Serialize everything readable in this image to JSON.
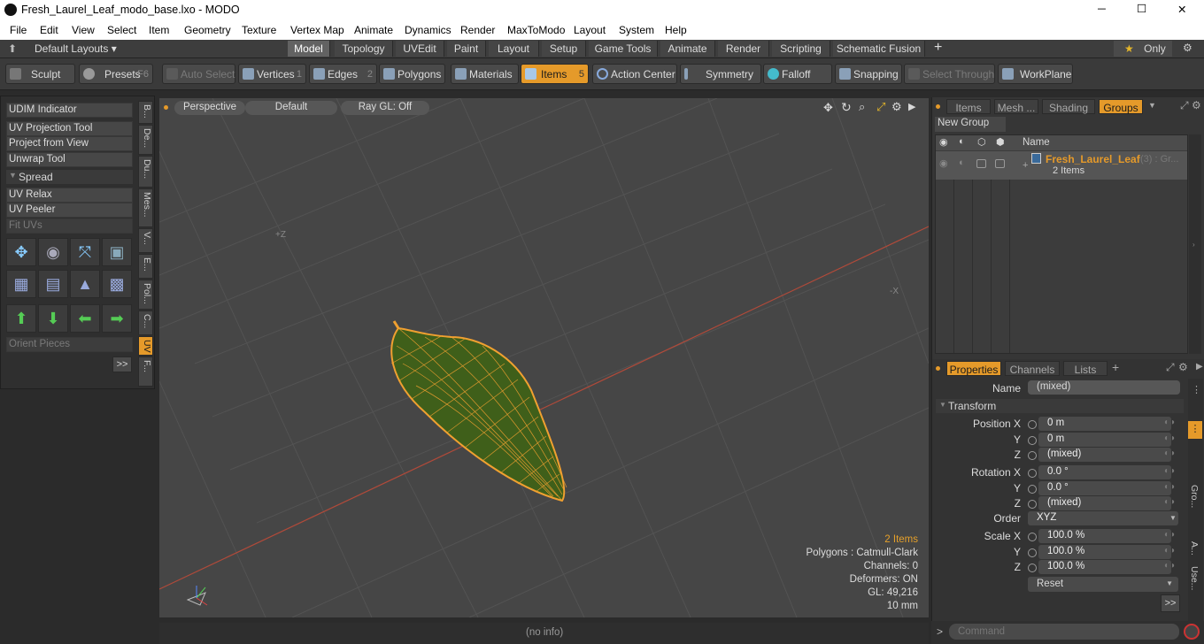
{
  "window": {
    "title": "Fresh_Laurel_Leaf_modo_base.lxo - MODO",
    "minimize": "─",
    "maximize": "☐",
    "close": "✕"
  },
  "menu": [
    "File",
    "Edit",
    "View",
    "Select",
    "Item",
    "Geometry",
    "Texture",
    "Vertex Map",
    "Animate",
    "Dynamics",
    "Render",
    "MaxToModo",
    "Layout",
    "System",
    "Help"
  ],
  "layouts": {
    "label": "Default Layouts ▾",
    "tabs": [
      "Model",
      "Topology",
      "UVEdit",
      "Paint",
      "Layout",
      "Setup",
      "Game Tools",
      "Animate",
      "Render",
      "Scripting",
      "Schematic Fusion"
    ],
    "active": "Model",
    "add": "+",
    "only": "Only"
  },
  "toolbar": {
    "sculpt": "Sculpt",
    "presets": "Presets",
    "presets_key": "F6",
    "auto_select": "Auto Select",
    "vertices": "Vertices",
    "vertices_key": "1",
    "edges": "Edges",
    "edges_key": "2",
    "polygons": "Polygons",
    "materials": "Materials",
    "items": "Items",
    "items_key": "5",
    "action_center": "Action Center",
    "symmetry": "Symmetry",
    "falloff": "Falloff",
    "snapping": "Snapping",
    "select_through": "Select Through",
    "workplane": "WorkPlane"
  },
  "left": {
    "udim": "UDIM Indicator",
    "uv_projection": "UV Projection Tool",
    "project_from_view": "Project from View",
    "unwrap": "Unwrap Tool",
    "spread": "Spread",
    "uv_relax": "UV Relax",
    "uv_peeler": "UV Peeler",
    "fit_uvs": "Fit UVs",
    "orient": "Orient Pieces",
    "more": ">>",
    "vtabs": [
      "B...",
      "De...",
      "Du...",
      "Mes...",
      "V...",
      "E...",
      "Pol...",
      "C...",
      "UV",
      "F..."
    ]
  },
  "viewport": {
    "perspective": "Perspective",
    "default": "Default",
    "raygl": "Ray GL: Off",
    "plus_z": "+Z",
    "minus_x": "-X",
    "info": {
      "items": "2 Items",
      "polygons": "Polygons : Catmull-Clark",
      "channels": "Channels: 0",
      "deformers": "Deformers: ON",
      "gl": "GL: 49,216",
      "unit": "10 mm"
    }
  },
  "status": "(no info)",
  "groups": {
    "tabs": [
      "Items",
      "Mesh ...",
      "Shading",
      "Groups"
    ],
    "active": "Groups",
    "new_group": "New Group",
    "name_col": "Name",
    "row_name": "Fresh_Laurel_Leaf",
    "row_count": "(3) : Gr...",
    "row_sub": "2 Items"
  },
  "props": {
    "tabs": [
      "Properties",
      "Channels",
      "Lists"
    ],
    "active": "Properties",
    "name_label": "Name",
    "name_value": "(mixed)",
    "transform": "Transform",
    "rows": [
      {
        "label": "Position X",
        "value": "0 m"
      },
      {
        "label": "Y",
        "value": "0 m"
      },
      {
        "label": "Z",
        "value": "(mixed)"
      },
      {
        "label": "Rotation X",
        "value": "0.0 °"
      },
      {
        "label": "Y",
        "value": "0.0 °"
      },
      {
        "label": "Z",
        "value": "(mixed)"
      },
      {
        "label": "Order",
        "value": "XYZ"
      },
      {
        "label": "Scale X",
        "value": "100.0 %"
      },
      {
        "label": "Y",
        "value": "100.0 %"
      },
      {
        "label": "Z",
        "value": "100.0 %"
      }
    ],
    "reset": "Reset",
    "more": ">>",
    "side_tabs": [
      "Gro...",
      "A...",
      "Use..."
    ]
  },
  "command": {
    "placeholder": "Command",
    "prompt": ">"
  },
  "colors": {
    "accent": "#e59a2a",
    "leaf_wire": "#f0a030",
    "leaf_fill": "#3f5f1a"
  }
}
